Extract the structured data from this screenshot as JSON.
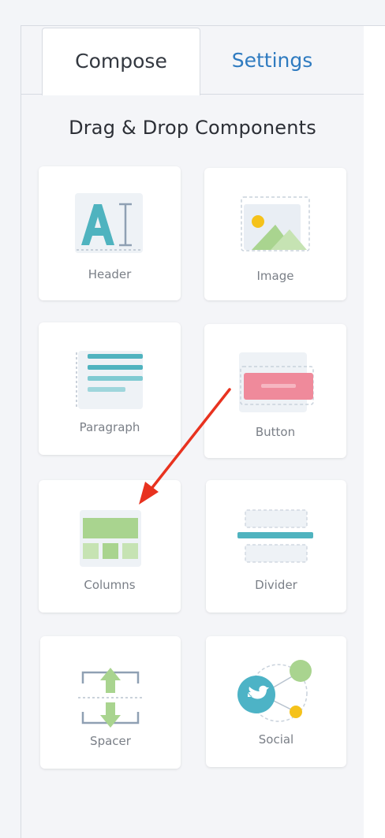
{
  "tabs": {
    "compose": "Compose",
    "settings": "Settings"
  },
  "heading": "Drag & Drop Components",
  "components": {
    "header": "Header",
    "image": "Image",
    "paragraph": "Paragraph",
    "button": "Button",
    "columns": "Columns",
    "divider": "Divider",
    "spacer": "Spacer",
    "social": "Social"
  },
  "colors": {
    "accent_link": "#2f7bc0",
    "teal": "#4fb3bf",
    "green": "#a9d48f",
    "pink": "#ef8a9b",
    "twitter": "#4db3c6",
    "yellow": "#f5c21b",
    "arrow": "#e8321f"
  },
  "icons": [
    "text-icon",
    "image-icon",
    "paragraph-icon",
    "button-icon",
    "columns-icon",
    "divider-icon",
    "spacer-icon",
    "social-icon"
  ]
}
